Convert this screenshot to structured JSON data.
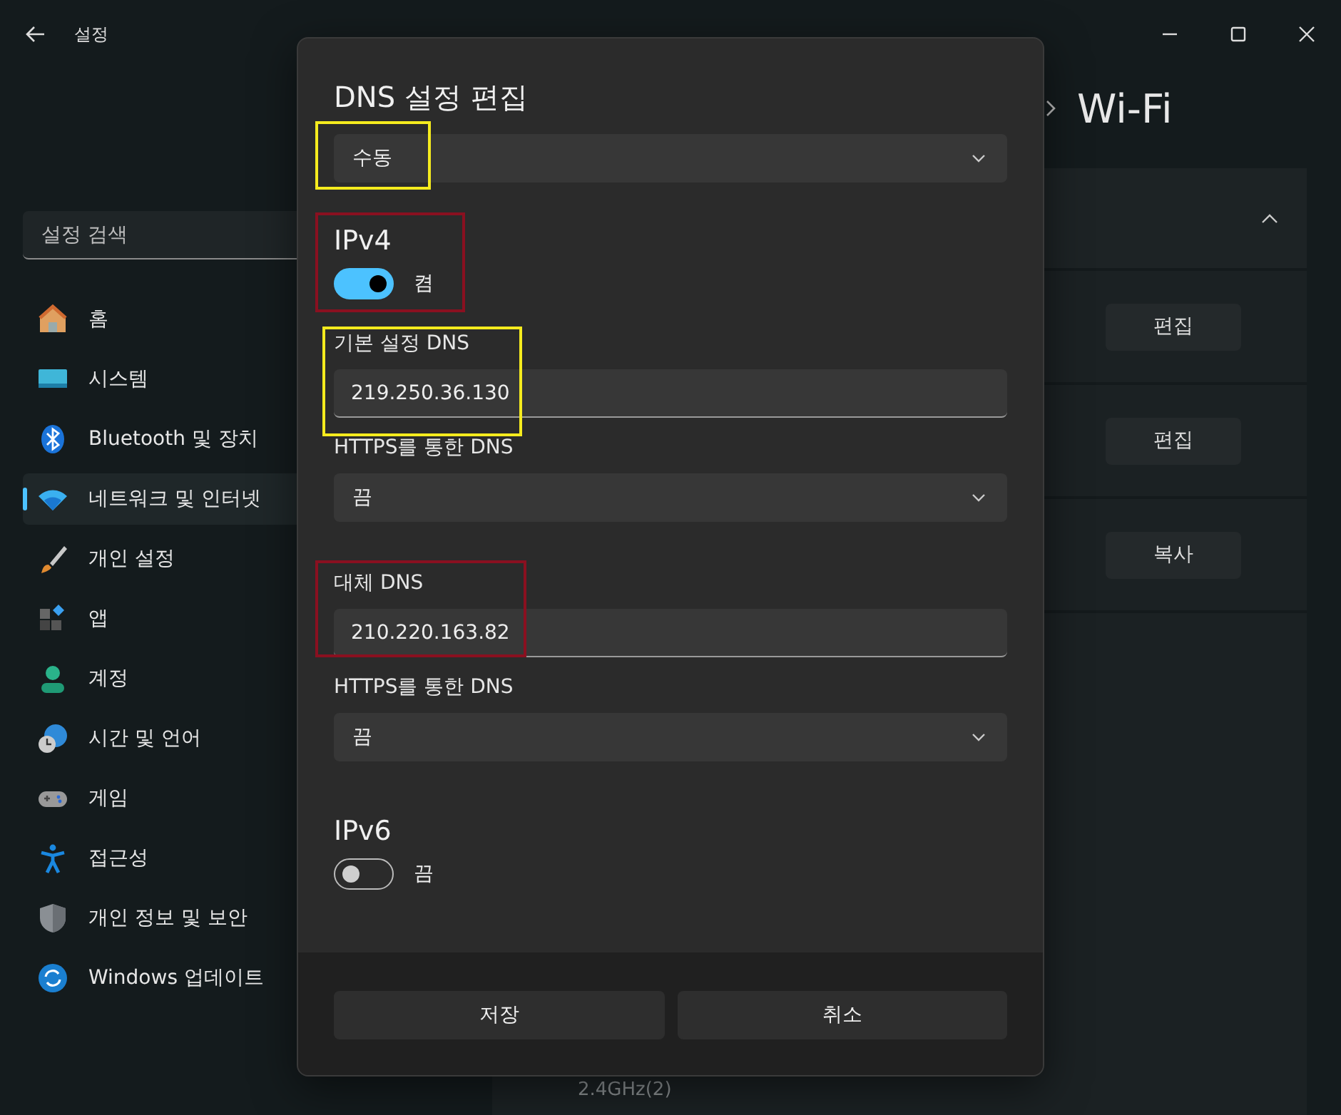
{
  "window": {
    "title": "설정"
  },
  "sidebar": {
    "search": {
      "placeholder": "설정 검색"
    },
    "items": [
      {
        "label": "홈",
        "selected": false
      },
      {
        "label": "시스템",
        "selected": false
      },
      {
        "label": "Bluetooth 및 장치",
        "selected": false
      },
      {
        "label": "네트워크 및 인터넷",
        "selected": true
      },
      {
        "label": "개인 설정",
        "selected": false
      },
      {
        "label": "앱",
        "selected": false
      },
      {
        "label": "계정",
        "selected": false
      },
      {
        "label": "시간 및 언어",
        "selected": false
      },
      {
        "label": "게임",
        "selected": false
      },
      {
        "label": "접근성",
        "selected": false
      },
      {
        "label": "개인 정보 및 보안",
        "selected": false
      },
      {
        "label": "Windows 업데이트",
        "selected": false
      }
    ]
  },
  "page": {
    "title": "Wi-Fi",
    "card": {
      "expanded": true,
      "rows": [
        {
          "button": "편집"
        },
        {
          "button": "편집"
        },
        {
          "button": "복사"
        }
      ]
    },
    "footer_text": "2.4GHz(2)"
  },
  "dialog": {
    "title": "DNS 설정 편집",
    "mode": "수동",
    "ipv4": {
      "heading": "IPv4",
      "on": true,
      "state": "켬",
      "primary_label": "기본 설정 DNS",
      "primary_value": "219.250.36.130",
      "primary_https_label": "HTTPS를 통한 DNS",
      "primary_https": "끔",
      "alternate_label": "대체 DNS",
      "alternate_value": "210.220.163.82",
      "alternate_https_label": "HTTPS를 통한 DNS",
      "alternate_https": "끔"
    },
    "ipv6": {
      "heading": "IPv6",
      "on": false,
      "state": "끔"
    },
    "buttons": [
      "저장",
      "취소"
    ]
  },
  "annotations": [
    {
      "color": "#f5eb1e"
    },
    {
      "color": "#8a1020"
    },
    {
      "color": "#f5eb1e"
    },
    {
      "color": "#8a1020"
    }
  ]
}
